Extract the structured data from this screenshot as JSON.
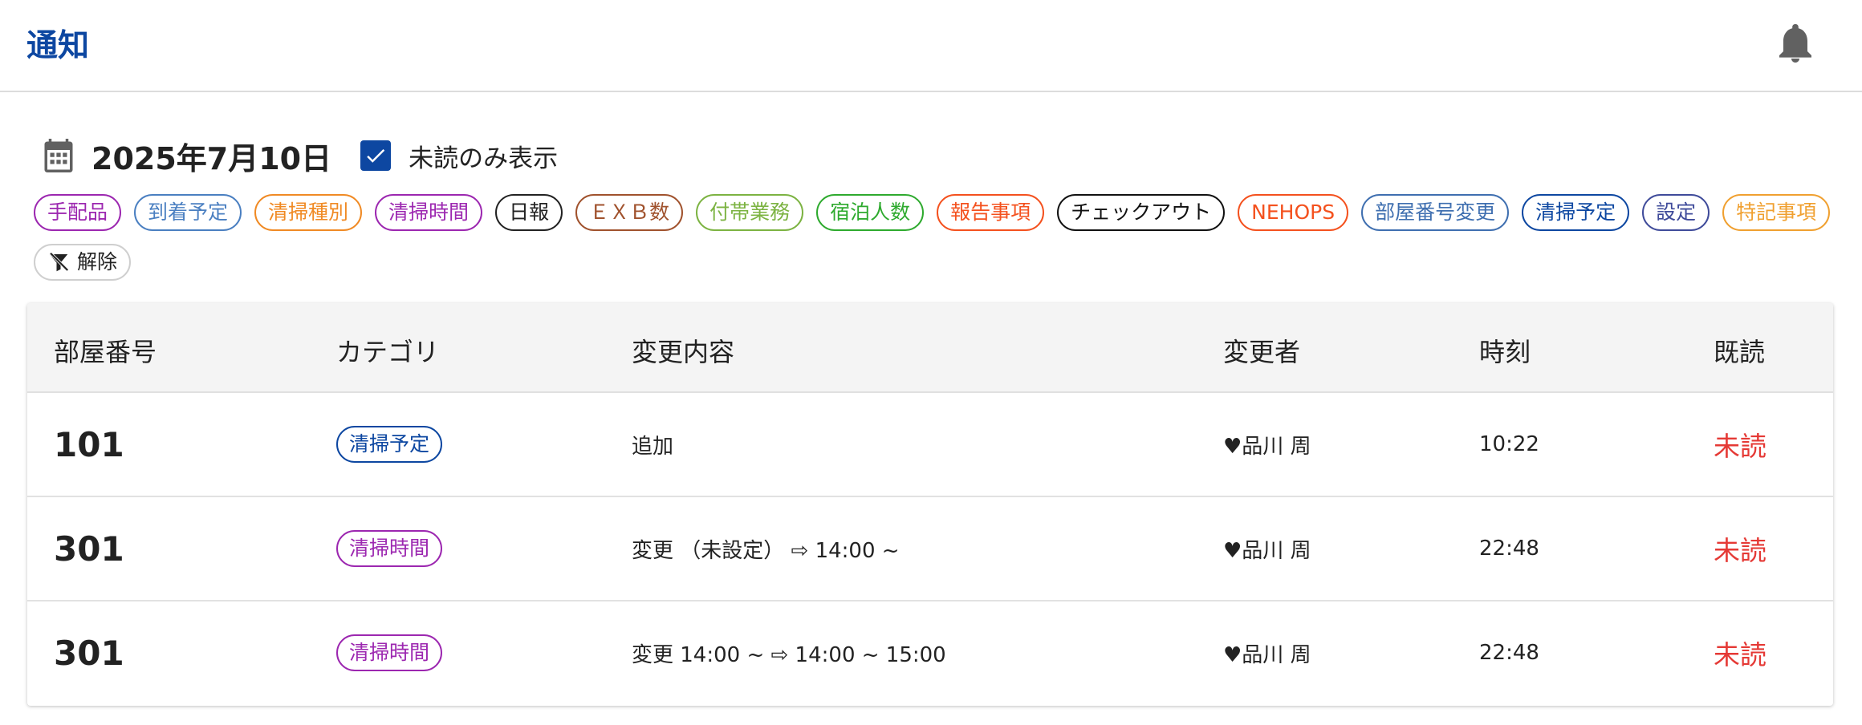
{
  "header": {
    "title": "通知",
    "bell_icon": "bell-icon"
  },
  "filter_bar": {
    "date": "2025年7月10日",
    "calendar_icon": "calendar-icon",
    "unread_only_checked": true,
    "unread_only_label": "未読のみ表示"
  },
  "chips": [
    {
      "label": "手配品",
      "color": "#9c27b0"
    },
    {
      "label": "到着予定",
      "color": "#4a7fc1"
    },
    {
      "label": "清掃種別",
      "color": "#f08a24"
    },
    {
      "label": "清掃時間",
      "color": "#9c27b0"
    },
    {
      "label": "日報",
      "color": "#222222"
    },
    {
      "label": "ＥＸＢ数",
      "color": "#a0522d"
    },
    {
      "label": "付帯業務",
      "color": "#7cb342"
    },
    {
      "label": "宿泊人数",
      "color": "#2eaa2e"
    },
    {
      "label": "報告事項",
      "color": "#f4511e"
    },
    {
      "label": "チェックアウト",
      "color": "#111111"
    },
    {
      "label": "NEHOPS",
      "color": "#f4511e"
    },
    {
      "label": "部屋番号変更",
      "color": "#3f6fb0"
    },
    {
      "label": "清掃予定",
      "color": "#0d47a1"
    },
    {
      "label": "設定",
      "color": "#3f4b9a"
    },
    {
      "label": "特記事項",
      "color": "#f0a030"
    }
  ],
  "clear_chip": {
    "label": "解除",
    "icon": "filter-off-icon"
  },
  "table": {
    "headers": {
      "room": "部屋番号",
      "category": "カテゴリ",
      "change": "変更内容",
      "changer": "変更者",
      "time": "時刻",
      "read": "既読"
    },
    "rows": [
      {
        "room": "101",
        "category": "清掃予定",
        "category_color": "#0d47a1",
        "change": "追加",
        "changer": "♥品川 周",
        "time": "10:22",
        "status": "未読"
      },
      {
        "room": "301",
        "category": "清掃時間",
        "category_color": "#9c27b0",
        "change": "変更 （未設定） ⇨ 14:00 ~",
        "changer": "♥品川 周",
        "time": "22:48",
        "status": "未読"
      },
      {
        "room": "301",
        "category": "清掃時間",
        "category_color": "#9c27b0",
        "change": "変更 14:00 ~ ⇨ 14:00 ~ 15:00",
        "changer": "♥品川 周",
        "time": "22:48",
        "status": "未読"
      }
    ]
  }
}
